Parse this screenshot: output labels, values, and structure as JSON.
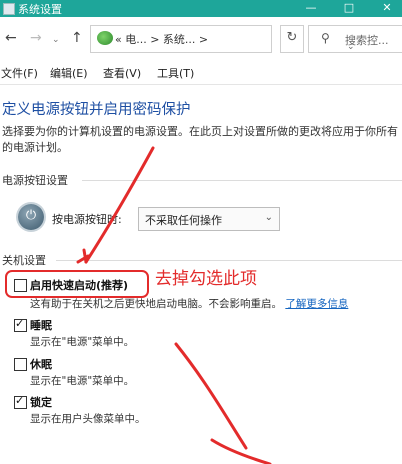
{
  "window": {
    "title": "系统设置",
    "min_glyph": "—",
    "max_glyph": "□",
    "close_glyph": "✕"
  },
  "nav": {
    "back": "←",
    "forward": "→",
    "dropdown": "⌄",
    "up": "↑",
    "breadcrumb": "«  电...  >  系统...  >",
    "refresh": "↻",
    "search_icon": "⚲",
    "search_placeholder": "搜索控..."
  },
  "menu": [
    "文件(F)",
    "编辑(E)",
    "查看(V)",
    "工具(T)"
  ],
  "page": {
    "title": "定义电源按钮并启用密码保护",
    "description": "选择要为你的计算机设置的电源设置。在此页上对设置所做的更改将应用于你所有的电源计划。"
  },
  "power_section": {
    "heading": "电源按钮设置",
    "label": "按电源按钮时:",
    "select_value": "不采取任何操作",
    "select_arrow": "⌄"
  },
  "shutdown_section": {
    "heading": "关机设置",
    "items": [
      {
        "label": "启用快速启动(推荐)",
        "checked": false,
        "desc": "这有助于在关机之后更快地启动电脑。不会影响重启。",
        "link": "了解更多信息"
      },
      {
        "label": "睡眠",
        "checked": true,
        "desc": "显示在\"电源\"菜单中。"
      },
      {
        "label": "休眠",
        "checked": false,
        "desc": "显示在\"电源\"菜单中。"
      },
      {
        "label": "锁定",
        "checked": true,
        "desc": "显示在用户头像菜单中。"
      }
    ]
  },
  "annotation": {
    "text": "去掉勾选此项",
    "color": "#e32b2b"
  },
  "colors": {
    "titlebar": "#1ea69a",
    "title_text": "#1e4fa3",
    "link": "#1565c0"
  }
}
